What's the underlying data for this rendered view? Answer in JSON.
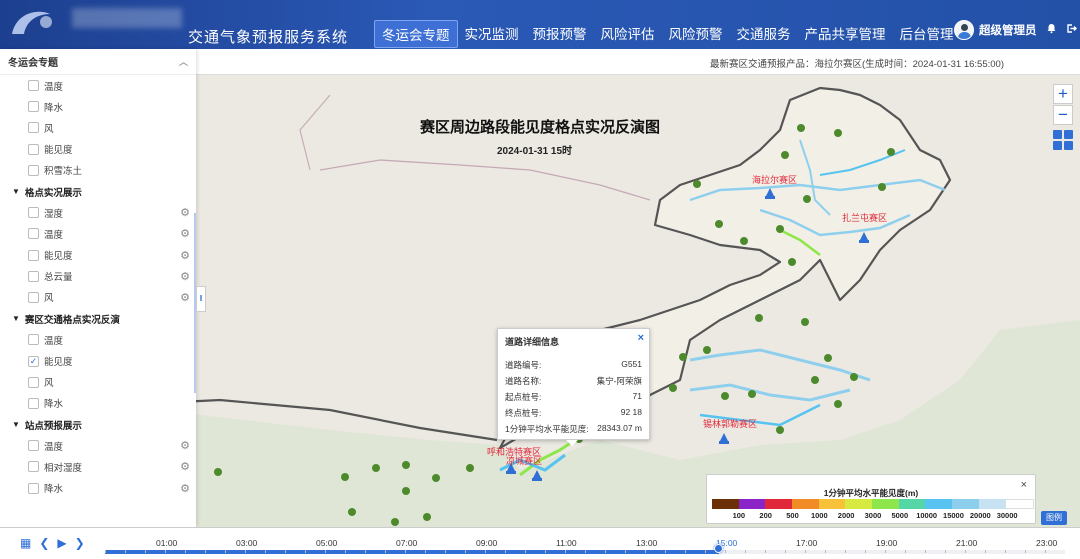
{
  "header": {
    "app_title": "交通气象预报服务系统",
    "nav": [
      "冬运会专题",
      "实况监测",
      "预报预警",
      "风险评估",
      "风险预警",
      "交通服务",
      "产品共享管理",
      "后台管理"
    ],
    "active_nav": 0,
    "user_name": "超级管理员"
  },
  "product_info": "最新赛区交通预报产品：海拉尔赛区(生成时间：2024-01-31 16:55:00)",
  "map": {
    "title": "赛区周边路段能见度格点实况反演图",
    "time": "2024-01-31 15时",
    "zones": [
      "海拉尔赛区",
      "扎兰屯赛区",
      "锡林郭勒赛区",
      "呼和浩特赛区",
      "凉城赛区"
    ]
  },
  "sidebar": {
    "title": "冬运会专题",
    "rows": [
      {
        "type": "item",
        "label": "温度",
        "checked": false,
        "gear": false
      },
      {
        "type": "item",
        "label": "降水",
        "checked": false,
        "gear": false
      },
      {
        "type": "item",
        "label": "风",
        "checked": false,
        "gear": false
      },
      {
        "type": "item",
        "label": "能见度",
        "checked": false,
        "gear": false
      },
      {
        "type": "item",
        "label": "积雪冻土",
        "checked": false,
        "gear": false
      },
      {
        "type": "group",
        "label": "格点实况展示"
      },
      {
        "type": "item",
        "label": "湿度",
        "checked": false,
        "gear": true
      },
      {
        "type": "item",
        "label": "温度",
        "checked": false,
        "gear": true
      },
      {
        "type": "item",
        "label": "能见度",
        "checked": false,
        "gear": true
      },
      {
        "type": "item",
        "label": "总云量",
        "checked": false,
        "gear": true
      },
      {
        "type": "item",
        "label": "风",
        "checked": false,
        "gear": true
      },
      {
        "type": "group",
        "label": "赛区交通格点实况反演"
      },
      {
        "type": "item",
        "label": "温度",
        "checked": false,
        "gear": false
      },
      {
        "type": "item",
        "label": "能见度",
        "checked": true,
        "gear": false
      },
      {
        "type": "item",
        "label": "风",
        "checked": false,
        "gear": false
      },
      {
        "type": "item",
        "label": "降水",
        "checked": false,
        "gear": false
      },
      {
        "type": "group",
        "label": "站点预报展示"
      },
      {
        "type": "item",
        "label": "温度",
        "checked": false,
        "gear": true
      },
      {
        "type": "item",
        "label": "相对湿度",
        "checked": false,
        "gear": true
      },
      {
        "type": "item",
        "label": "降水",
        "checked": false,
        "gear": true
      }
    ]
  },
  "popup": {
    "title": "道路详细信息",
    "rows": [
      {
        "label": "道路编号:",
        "value": "G551"
      },
      {
        "label": "道路名称:",
        "value": "集宁-阿荣旗"
      },
      {
        "label": "起点桩号:",
        "value": "71"
      },
      {
        "label": "终点桩号:",
        "value": "92 18"
      },
      {
        "label": "1分钟平均水平能见度:",
        "value": "28343.07 m"
      }
    ]
  },
  "legend": {
    "title": "1分钟平均水平能见度(m)",
    "colors": [
      "#6b2f06",
      "#8a24c8",
      "#e0283a",
      "#f08b26",
      "#f7c13a",
      "#d6ea3f",
      "#8de64a",
      "#55d6a6",
      "#56c3f0",
      "#8fcfee",
      "#c6e3f3",
      "#ffffff"
    ],
    "labels": [
      "100",
      "200",
      "500",
      "1000",
      "2000",
      "3000",
      "5000",
      "10000",
      "15000",
      "20000",
      "30000"
    ],
    "button": "图例"
  },
  "timeline": {
    "labels": [
      "01:00",
      "03:00",
      "05:00",
      "07:00",
      "09:00",
      "11:00",
      "13:00",
      "15:00",
      "17:00",
      "19:00",
      "21:00",
      "23:00"
    ],
    "active_label": "15:00",
    "progress_fraction": 0.64
  }
}
